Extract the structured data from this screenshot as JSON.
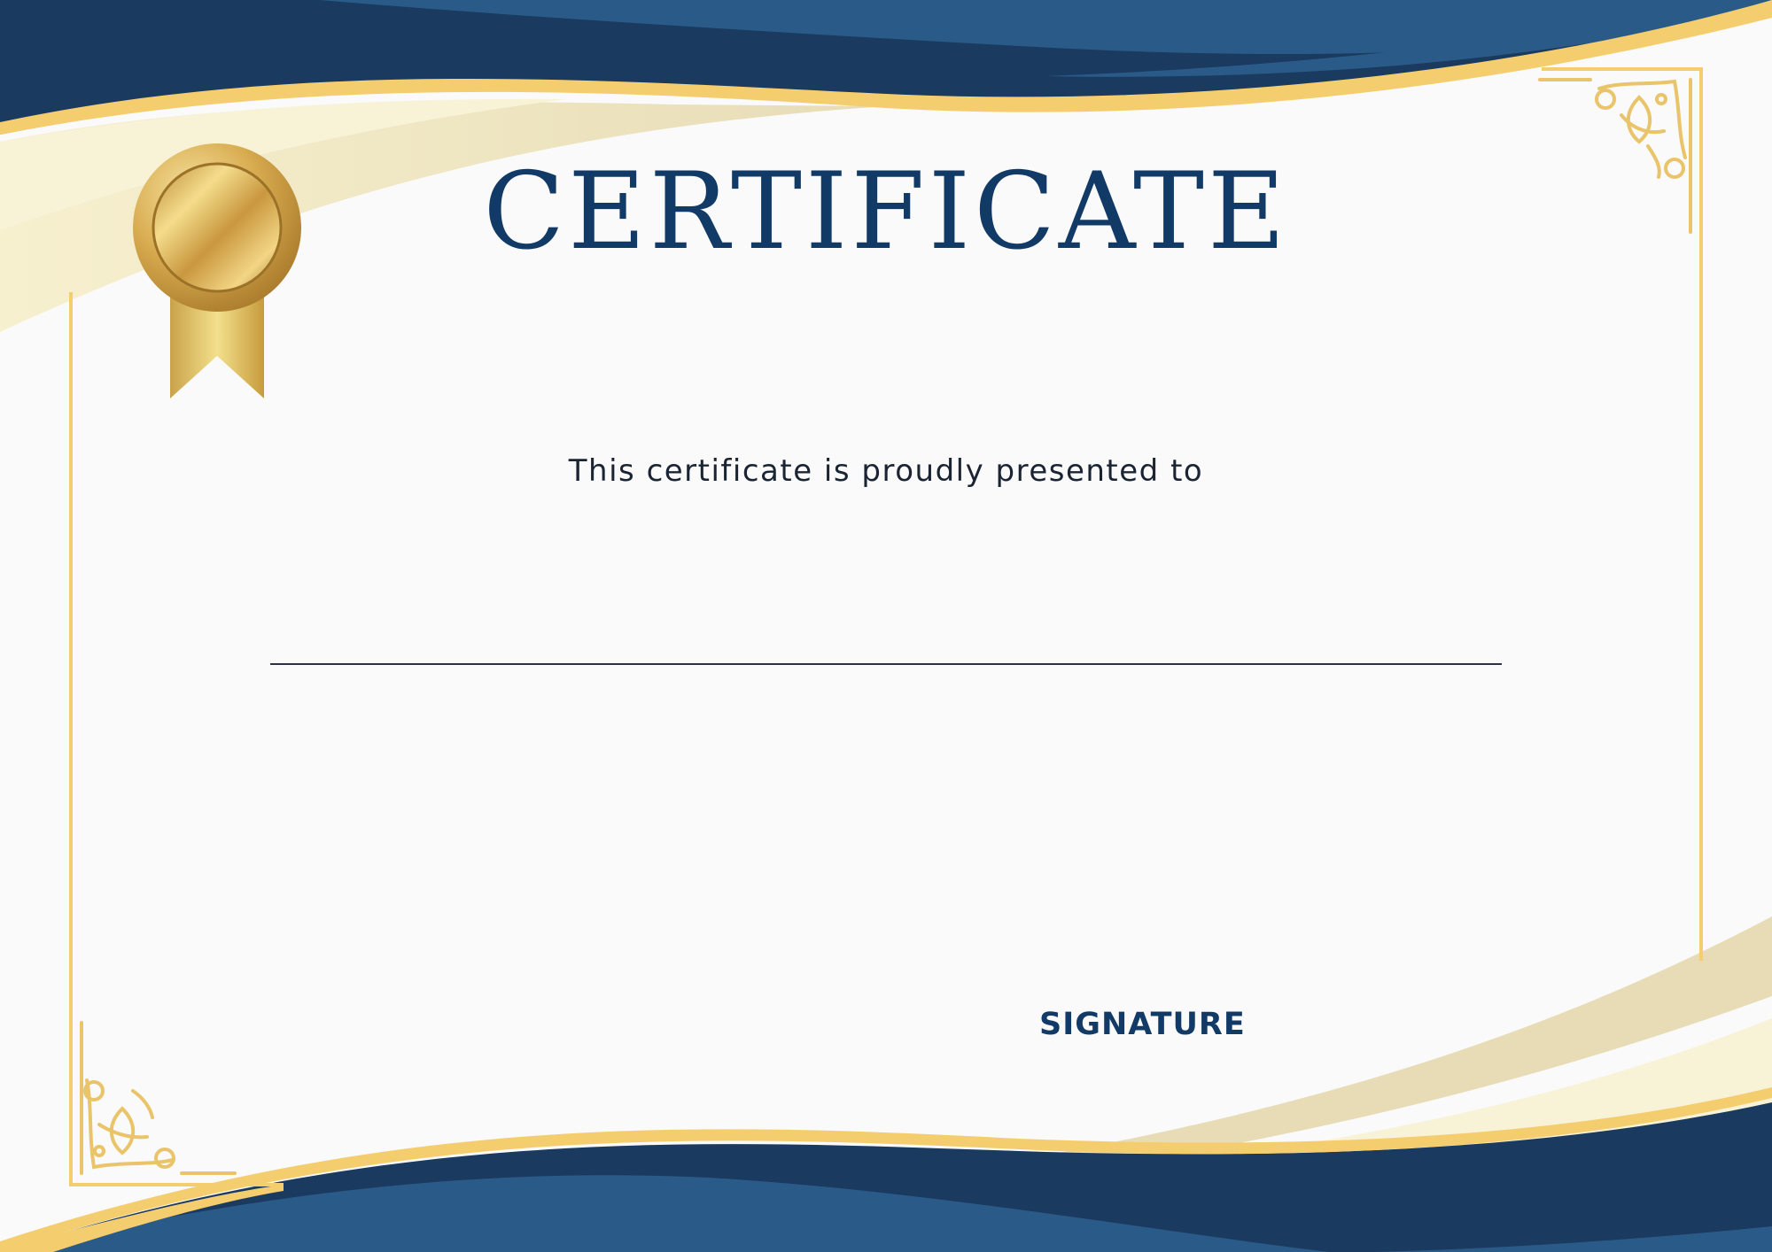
{
  "certificate": {
    "title": "CERTIFICATE",
    "subtitle": "This certificate is proudly presented to",
    "signature_label": "SIGNATURE"
  },
  "colors": {
    "navy": "#1b3a5f",
    "blue": "#2a5a87",
    "gold": "#f4cd6f",
    "cream": "#ece3c4",
    "paper": "#fafafa",
    "title_text": "#123a66"
  },
  "icons": {
    "seal": "gold-medal-ribbon-icon",
    "corner_top_right": "ornamental-corner-icon",
    "corner_bottom_left": "ornamental-corner-icon"
  }
}
